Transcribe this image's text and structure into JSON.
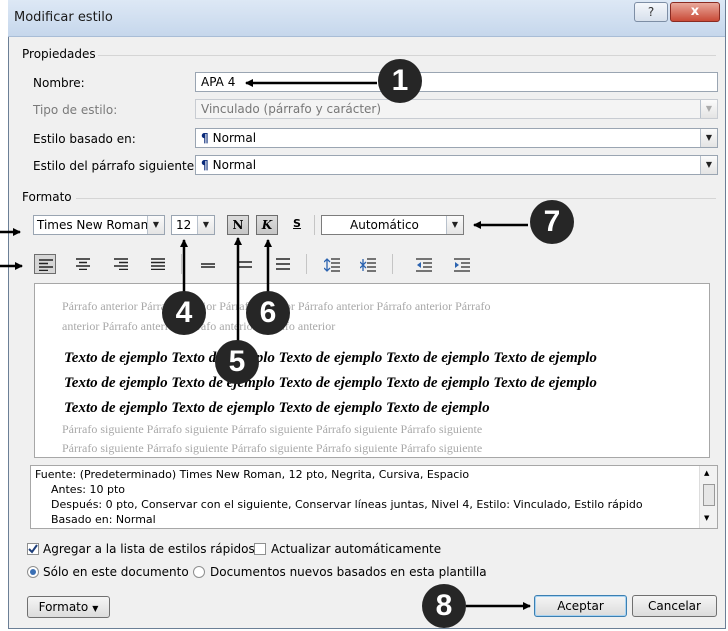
{
  "window": {
    "title": "Modificar estilo",
    "help_label": "?",
    "close_label": "x"
  },
  "propiedades": {
    "section": "Propiedades",
    "nombre_label": "Nombre:",
    "nombre_value": "APA 4",
    "tipo_label": "Tipo de estilo:",
    "tipo_value": "Vinculado (párrafo y carácter)",
    "basado_label": "Estilo basado en:",
    "basado_value": "Normal",
    "siguiente_label": "Estilo del párrafo siguiente:",
    "siguiente_value": "Normal"
  },
  "formato": {
    "section": "Formato",
    "font": "Times New Roman",
    "size": "12",
    "bold": "N",
    "italic": "K",
    "underline": "S",
    "color": "Automático"
  },
  "preview": {
    "prev1": "Párrafo anterior Párrafo anterior Párrafo anterior Párrafo anterior Párrafo anterior Párrafo",
    "prev2": "anterior Párrafo anterior Párrafo anterior Párrafo anterior",
    "sample1": "Texto de ejemplo Texto de ejemplo Texto de ejemplo Texto de ejemplo Texto de ejemplo",
    "sample2": "Texto de ejemplo Texto de ejemplo Texto de ejemplo Texto de ejemplo Texto de ejemplo",
    "sample3": "Texto de ejemplo Texto de ejemplo Texto de ejemplo Texto de ejemplo",
    "next1": "Párrafo siguiente Párrafo siguiente Párrafo siguiente Párrafo siguiente Párrafo siguiente",
    "next2": "Párrafo siguiente Párrafo siguiente Párrafo siguiente Párrafo siguiente Párrafo siguiente"
  },
  "description": {
    "line1": "Fuente: (Predeterminado) Times New Roman, 12 pto, Negrita, Cursiva, Espacio",
    "line2": "Antes:  10 pto",
    "line3": "Después:  0 pto, Conservar con el siguiente, Conservar líneas juntas, Nivel 4, Estilo: Vinculado, Estilo rápido",
    "line4": "Basado en: Normal"
  },
  "options": {
    "add_quick": "Agregar a la lista de estilos rápidos",
    "add_quick_checked": true,
    "auto_update": "Actualizar automáticamente",
    "auto_update_checked": false,
    "only_doc": "Sólo en este documento",
    "new_docs": "Documentos nuevos basados en esta plantilla"
  },
  "buttons": {
    "formato": "Formato",
    "aceptar": "Aceptar",
    "cancelar": "Cancelar"
  },
  "callouts": {
    "c1": "1",
    "c4": "4",
    "c5": "5",
    "c6": "6",
    "c7": "7",
    "c8": "8"
  }
}
